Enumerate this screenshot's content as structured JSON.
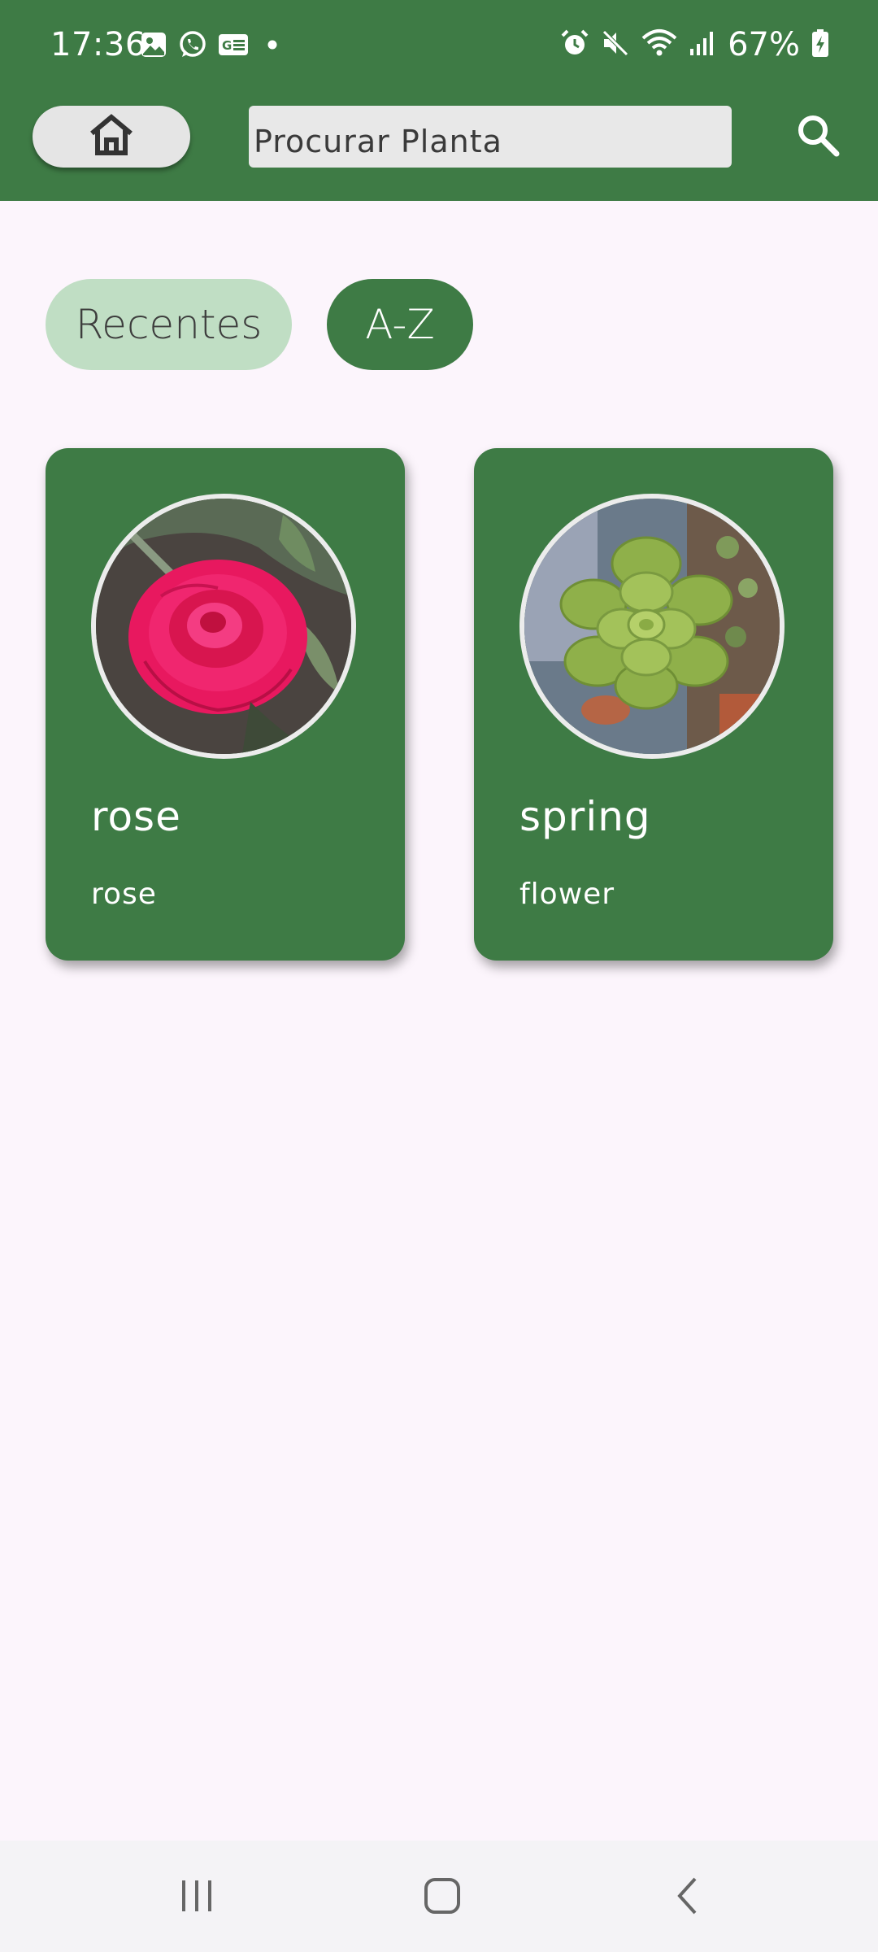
{
  "status_bar": {
    "time": "17:36",
    "battery_text": "67%",
    "left_icons": [
      "gallery-icon",
      "whatsapp-icon",
      "id-card-icon",
      "dot-icon"
    ],
    "right_icons": [
      "alarm-icon",
      "mute-icon",
      "wifi-icon",
      "signal-icon",
      "battery-charging-icon"
    ]
  },
  "toolbar": {
    "home_icon": "home-icon",
    "search_value": "Procurar Planta",
    "search_icon": "search-icon"
  },
  "filters": {
    "recentes": "Recentes",
    "az": "A-Z",
    "selected": "A-Z"
  },
  "plants": [
    {
      "name": "rose",
      "type": "rose",
      "photo": "rose-photo"
    },
    {
      "name": "spring",
      "type": "flower",
      "photo": "succulent-photo"
    }
  ],
  "navigation": {
    "icons": [
      "recents-icon",
      "home-nav-icon",
      "back-icon"
    ]
  },
  "colors": {
    "primary_green": "#3e7b45",
    "chip_light_green": "#c0dec4",
    "background": "#fcf5fc",
    "search_bg": "#e8e8e8"
  }
}
